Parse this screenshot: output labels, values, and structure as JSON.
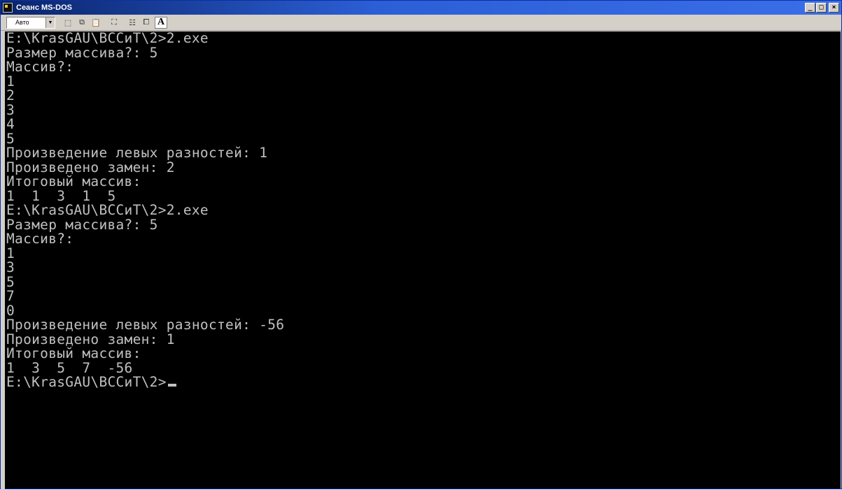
{
  "window": {
    "title": "Сеанс MS-DOS",
    "buttons": {
      "minimize": "_",
      "maximize": "□",
      "close": "×"
    }
  },
  "toolbar": {
    "font_value": "Авто",
    "icons": [
      "mark-icon",
      "copy-icon",
      "paste-icon",
      "fullscreen-icon",
      "properties-icon",
      "background-icon",
      "font-icon"
    ],
    "font_button": "A"
  },
  "console": {
    "lines": [
      "E:\\KrasGAU\\ВССиТ\\2>2.exe",
      "Размер массива?: 5",
      "Массив?:",
      "1",
      "2",
      "3",
      "4",
      "5",
      "Произведение левых разностей: 1",
      "Произведено замен: 2",
      "Итоговый массив:",
      "1  1  3  1  5",
      "E:\\KrasGAU\\ВССиТ\\2>2.exe",
      "Размер массива?: 5",
      "Массив?:",
      "1",
      "3",
      "5",
      "7",
      "0",
      "Произведение левых разностей: -56",
      "Произведено замен: 1",
      "Итоговый массив:",
      "1  3  5  7  -56",
      "E:\\KrasGAU\\ВССиТ\\2>"
    ]
  },
  "colors": {
    "console_bg": "#000000",
    "console_fg": "#c0c0c0",
    "titlebar": "#0a246a"
  }
}
